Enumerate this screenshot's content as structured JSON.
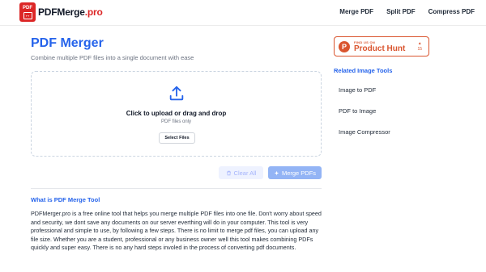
{
  "header": {
    "logo_badge_text": "PDF",
    "logo_badge_arrows": "↔",
    "logo_name": "PDFMerge",
    "logo_suffix": ".pro",
    "nav": [
      "Merge PDF",
      "Split PDF",
      "Compress PDF"
    ]
  },
  "main": {
    "title": "PDF Merger",
    "subtitle": "Combine multiple PDF files into a single document with ease",
    "dropzone": {
      "title": "Click to upload or drag and drop",
      "hint": "PDF files only",
      "select_label": "Select Files"
    },
    "clear_label": "Clear All",
    "merge_label": "Merge PDFs",
    "about_title": "What is PDF Merge Tool",
    "about_text": "PDFMerger.pro is a free online tool that helps you merge multiple PDF files into one file. Don't worry about speed and security, we dont save any documents on our server everthing will do in your computer. This tool is very professional and simple to use, by following a few steps. There is no limit to merge pdf files, you can upload any file size. Whether you are a student, professional or any business owner well this tool makes combining PDFs quickly and super easy. There is no any hard steps involed in the process of converting pdf documents."
  },
  "sidebar": {
    "product_hunt": {
      "letter": "P",
      "small_text": "FIND US ON",
      "name": "Product Hunt",
      "upvote_arrow": "▲",
      "upvotes": "15"
    },
    "related_title": "Related Image Tools",
    "links": [
      "Image to PDF",
      "PDF to Image",
      "Image Compressor"
    ]
  },
  "colors": {
    "primary": "#2563eb",
    "brand_red": "#dc2626",
    "product_hunt": "#da552f"
  },
  "icons": [
    "upload-icon",
    "trash-icon",
    "sparkle-icon"
  ]
}
